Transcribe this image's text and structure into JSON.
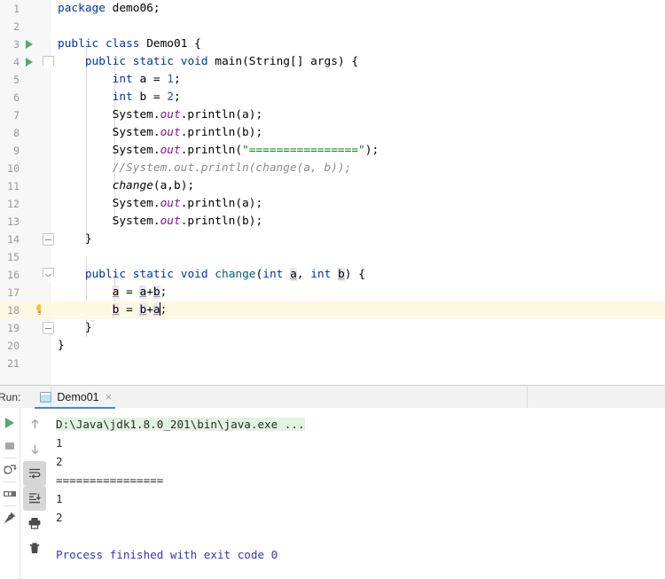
{
  "editor": {
    "first_line": 1,
    "last_line": 21,
    "highlighted_line": 18,
    "run_marker_lines": [
      3,
      4
    ],
    "lines": [
      {
        "n": 1,
        "text": "package demo06;"
      },
      {
        "n": 2,
        "text": ""
      },
      {
        "n": 3,
        "text": "public class Demo01 {"
      },
      {
        "n": 4,
        "text": "    public static void main(String[] args) {"
      },
      {
        "n": 5,
        "text": "        int a = 1;"
      },
      {
        "n": 6,
        "text": "        int b = 2;"
      },
      {
        "n": 7,
        "text": "        System.out.println(a);"
      },
      {
        "n": 8,
        "text": "        System.out.println(b);"
      },
      {
        "n": 9,
        "text": "        System.out.println(\"================\");"
      },
      {
        "n": 10,
        "text": "        //System.out.println(change(a, b));"
      },
      {
        "n": 11,
        "text": "        change(a,b);"
      },
      {
        "n": 12,
        "text": "        System.out.println(a);"
      },
      {
        "n": 13,
        "text": "        System.out.println(b);"
      },
      {
        "n": 14,
        "text": "    }"
      },
      {
        "n": 15,
        "text": ""
      },
      {
        "n": 16,
        "text": "    public static void change(int a, int b) {"
      },
      {
        "n": 17,
        "text": "        a = a+b;"
      },
      {
        "n": 18,
        "text": "        b = b+a;"
      },
      {
        "n": 19,
        "text": "    }"
      },
      {
        "n": 20,
        "text": "}"
      },
      {
        "n": 21,
        "text": ""
      }
    ],
    "colors": {
      "keyword": "#0033b3",
      "string": "#067d17",
      "number": "#1750eb",
      "comment": "#8c8c8c",
      "field": "#871094",
      "method": "#00627a",
      "line_highlight": "#fdf8e3",
      "gutter_bg": "#f7f7f7",
      "run_marker": "#59a869",
      "bulb": "#ffbb33"
    }
  },
  "run_panel": {
    "label": "Run:",
    "tab": {
      "name": "Demo01",
      "close": "×",
      "icon": "console-tab-icon"
    },
    "left_toolbar": [
      {
        "name": "rerun-button",
        "icon": "play-icon"
      },
      {
        "name": "stop-button",
        "icon": "stop-square-icon"
      },
      {
        "name": "rerun-failed-tests-button",
        "icon": "rerun-debug-icon"
      },
      {
        "name": "layout-settings-button",
        "icon": "layout-icon"
      },
      {
        "name": "pin-tab-button",
        "icon": "pin-icon"
      }
    ],
    "right_toolbar": [
      {
        "name": "up-button",
        "icon": "arrow-up-icon",
        "active": false
      },
      {
        "name": "down-button",
        "icon": "arrow-down-icon",
        "active": false
      },
      {
        "name": "soft-wrap-button",
        "icon": "soft-wrap-icon",
        "active": true
      },
      {
        "name": "scroll-to-end-button",
        "icon": "scroll-to-end-icon",
        "active": true
      },
      {
        "name": "print-button",
        "icon": "printer-icon",
        "active": false
      },
      {
        "name": "clear-all-button",
        "icon": "trash-icon",
        "active": false
      }
    ],
    "console_output": [
      {
        "text": "D:\\Java\\jdk1.8.0_201\\bin\\java.exe ...",
        "style": "path"
      },
      {
        "text": "1",
        "style": "plain"
      },
      {
        "text": "2",
        "style": "plain"
      },
      {
        "text": "================",
        "style": "plain"
      },
      {
        "text": "1",
        "style": "plain"
      },
      {
        "text": "2",
        "style": "plain"
      },
      {
        "text": "",
        "style": "plain"
      },
      {
        "text": "Process finished with exit code 0",
        "style": "sys"
      }
    ],
    "colors": {
      "path_highlight": "#e1f3e1",
      "system_text": "#3333cc",
      "tab_underline": "#4a86c7"
    }
  }
}
